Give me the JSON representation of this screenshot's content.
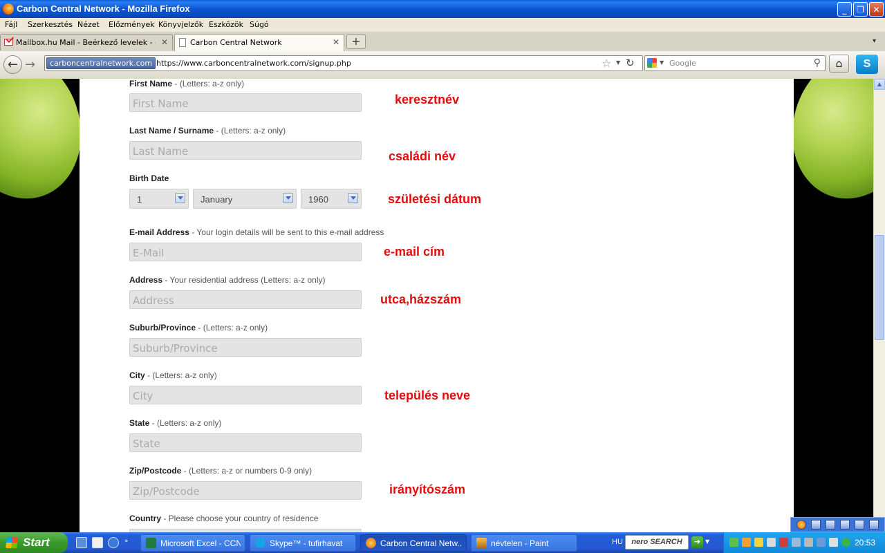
{
  "window": {
    "title": "Carbon Central Network - Mozilla Firefox"
  },
  "menu": [
    "Fájl",
    "Szerkesztés",
    "Nézet",
    "Előzmények",
    "Könyvjelzők",
    "Eszközök",
    "Súgó"
  ],
  "tabs": [
    {
      "label": "Mailbox.hu Mail - Beérkező levelek - ccn...",
      "close": "✕"
    },
    {
      "label": "Carbon Central Network",
      "close": "✕"
    }
  ],
  "newtab": "+",
  "tablist": "▾",
  "nav": {
    "identity": "carboncentralnetwork.com",
    "url": "https://www.carboncentralnetwork.com/signup.php",
    "search_placeholder": "Google"
  },
  "form": {
    "first_name": {
      "label": "First Name",
      "hint": " - (Letters: a-z only)",
      "placeholder": "First Name"
    },
    "last_name": {
      "label": "Last Name / Surname",
      "hint": " - (Letters: a-z only)",
      "placeholder": "Last Name"
    },
    "birth_date": {
      "label": "Birth Date",
      "day": "1",
      "month": "January",
      "year": "1960"
    },
    "email": {
      "label": "E-mail Address",
      "hint": " - Your login details will be sent to this e-mail address",
      "placeholder": "E-Mail"
    },
    "address": {
      "label": "Address",
      "hint": " - Your residential address (Letters: a-z only)",
      "placeholder": "Address"
    },
    "suburb": {
      "label": "Suburb/Province",
      "hint": " - (Letters: a-z only)",
      "placeholder": "Suburb/Province"
    },
    "city": {
      "label": "City",
      "hint": " - (Letters: a-z only)",
      "placeholder": "City"
    },
    "state": {
      "label": "State",
      "hint": " - (Letters: a-z only)",
      "placeholder": "State"
    },
    "zip": {
      "label": "Zip/Postcode",
      "hint": " - (Letters: a-z or numbers 0-9 only)",
      "placeholder": "Zip/Postcode"
    },
    "country": {
      "label": "Country",
      "hint": " - Please choose your country of residence"
    }
  },
  "annotations": {
    "first_name": "keresztnév",
    "last_name": "családi név",
    "birth_date": "születési dátum",
    "email": "e-mail cím",
    "address": "utca,házszám",
    "city": "település neve",
    "zip": "irányítószám"
  },
  "taskbar": {
    "start": "Start",
    "tasks": [
      {
        "label": "Microsoft Excel - CCN...",
        "icon": "excel-icon"
      },
      {
        "label": "Skype™ - tufirhavat",
        "icon": "skype-icon"
      },
      {
        "label": "Carbon Central Netw...",
        "icon": "firefox-icon"
      },
      {
        "label": "névtelen - Paint",
        "icon": "paint-icon"
      }
    ],
    "language": "HU",
    "nero_label": "nero SEARCH",
    "clock": "20:53"
  },
  "colors": {
    "annotation": "#e40c0c",
    "titlebar": "#0b55d0",
    "taskbar": "#245ed9",
    "tray": "#0f8ad8"
  }
}
